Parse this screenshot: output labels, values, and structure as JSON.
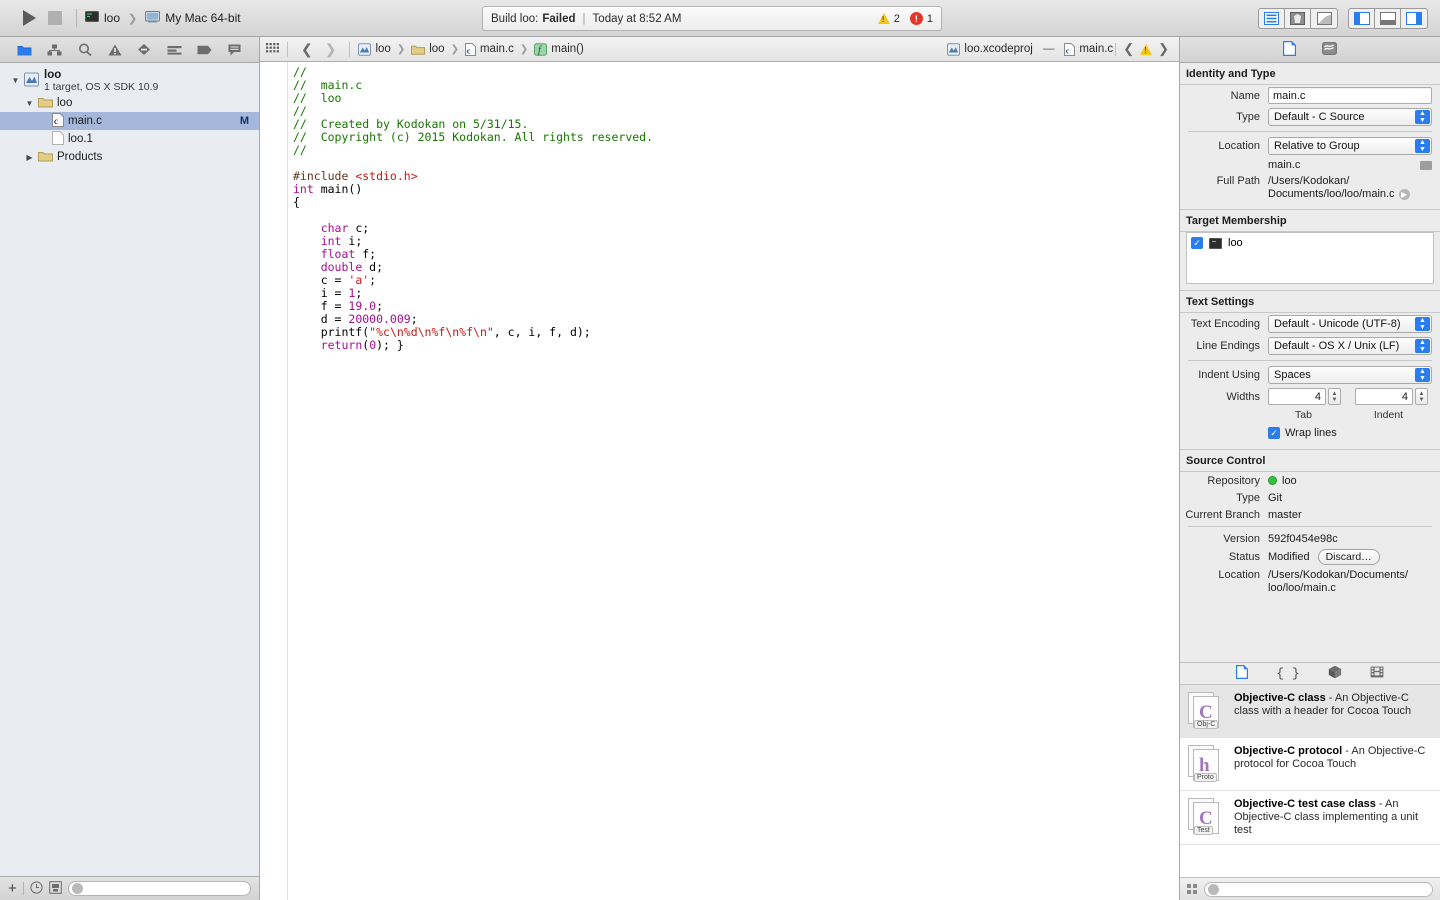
{
  "toolbar": {
    "run_label": "run-button",
    "stop_label": "stop-button",
    "scheme_name": "loo",
    "destination": "My Mac 64-bit",
    "status_prefix": "Build loo:",
    "status_result": "Failed",
    "status_divider": "|",
    "status_time": "Today at 8:52 AM",
    "warning_count": "2",
    "error_count": "1"
  },
  "navigator": {
    "tabs": [
      "project-navigator",
      "symbol-navigator",
      "find-navigator",
      "issue-navigator",
      "test-navigator",
      "debug-navigator",
      "breakpoint-navigator",
      "report-navigator"
    ],
    "tree": [
      {
        "label": "loo",
        "sublabel": "1 target, OS X SDK 10.9",
        "icon": "xcode-project-icon",
        "depth": 0,
        "expanded": true,
        "selected": false,
        "marker": ""
      },
      {
        "label": "loo",
        "sublabel": "",
        "icon": "folder-icon",
        "depth": 1,
        "expanded": true,
        "selected": false,
        "marker": ""
      },
      {
        "label": "main.c",
        "sublabel": "",
        "icon": "c-source-icon",
        "depth": 2,
        "expanded": null,
        "selected": true,
        "marker": "M"
      },
      {
        "label": "loo.1",
        "sublabel": "",
        "icon": "plain-file-icon",
        "depth": 2,
        "expanded": null,
        "selected": false,
        "marker": ""
      },
      {
        "label": "Products",
        "sublabel": "",
        "icon": "folder-icon",
        "depth": 1,
        "expanded": false,
        "selected": false,
        "marker": ""
      }
    ],
    "footer": {
      "add_label": "+",
      "filter_placeholder": ""
    }
  },
  "jumpbar": {
    "crumbs": [
      "loo",
      "loo",
      "main.c",
      "main()"
    ],
    "right_title_project": "loo.xcodeproj",
    "right_dash": "—",
    "right_title_file": "main.c"
  },
  "code": {
    "lines": [
      [
        {
          "t": "//",
          "c": "c-comment"
        }
      ],
      [
        {
          "t": "//  main.c",
          "c": "c-comment"
        }
      ],
      [
        {
          "t": "//  loo",
          "c": "c-comment"
        }
      ],
      [
        {
          "t": "//",
          "c": "c-comment"
        }
      ],
      [
        {
          "t": "//  Created by Kodokan on 5/31/15.",
          "c": "c-comment"
        }
      ],
      [
        {
          "t": "//  Copyright (c) 2015 Kodokan. All rights reserved.",
          "c": "c-comment"
        }
      ],
      [
        {
          "t": "//",
          "c": "c-comment"
        }
      ],
      [
        {
          "t": "",
          "c": ""
        }
      ],
      [
        {
          "t": "#include ",
          "c": "c-pre"
        },
        {
          "t": "<stdio.h>",
          "c": "c-hdr"
        }
      ],
      [
        {
          "t": "int",
          "c": "c-kw"
        },
        {
          "t": " main()",
          "c": "c-fn"
        }
      ],
      [
        {
          "t": "{",
          "c": "c-fn"
        }
      ],
      [
        {
          "t": "",
          "c": ""
        }
      ],
      [
        {
          "t": "    ",
          "c": ""
        },
        {
          "t": "char",
          "c": "c-kw"
        },
        {
          "t": " c;",
          "c": "c-fn"
        }
      ],
      [
        {
          "t": "    ",
          "c": ""
        },
        {
          "t": "int",
          "c": "c-kw"
        },
        {
          "t": " i;",
          "c": "c-fn"
        }
      ],
      [
        {
          "t": "    ",
          "c": ""
        },
        {
          "t": "float",
          "c": "c-kw"
        },
        {
          "t": " f;",
          "c": "c-fn"
        }
      ],
      [
        {
          "t": "    ",
          "c": ""
        },
        {
          "t": "double",
          "c": "c-kw"
        },
        {
          "t": " d;",
          "c": "c-fn"
        }
      ],
      [
        {
          "t": "    c = ",
          "c": "c-fn"
        },
        {
          "t": "'a'",
          "c": "c-str"
        },
        {
          "t": ";",
          "c": "c-fn"
        }
      ],
      [
        {
          "t": "    i = ",
          "c": "c-fn"
        },
        {
          "t": "1",
          "c": "c-esc"
        },
        {
          "t": ";",
          "c": "c-fn"
        }
      ],
      [
        {
          "t": "    f = ",
          "c": "c-fn"
        },
        {
          "t": "19.0",
          "c": "c-esc"
        },
        {
          "t": ";",
          "c": "c-fn"
        }
      ],
      [
        {
          "t": "    d = ",
          "c": "c-fn"
        },
        {
          "t": "20000.009",
          "c": "c-esc"
        },
        {
          "t": ";",
          "c": "c-fn"
        }
      ],
      [
        {
          "t": "    printf(",
          "c": "c-fn"
        },
        {
          "t": "\"%c\\n%d\\n%f\\n%f\\n\"",
          "c": "c-str"
        },
        {
          "t": ", c, i, f, d);",
          "c": "c-fn"
        }
      ],
      [
        {
          "t": "    ",
          "c": ""
        },
        {
          "t": "return",
          "c": "c-kw"
        },
        {
          "t": "(",
          "c": "c-fn"
        },
        {
          "t": "0",
          "c": "c-esc"
        },
        {
          "t": "); }",
          "c": "c-fn"
        }
      ]
    ]
  },
  "inspector": {
    "tabs": [
      "file-inspector",
      "quick-help-inspector"
    ],
    "identity": {
      "heading": "Identity and Type",
      "name_label": "Name",
      "name_value": "main.c",
      "type_label": "Type",
      "type_value": "Default - C Source",
      "location_label": "Location",
      "location_value": "Relative to Group",
      "location_file": "main.c",
      "fullpath_label": "Full Path",
      "fullpath_line1": "/Users/Kodokan/",
      "fullpath_line2": "Documents/loo/loo/main.c"
    },
    "target_membership": {
      "heading": "Target Membership",
      "items": [
        {
          "label": "loo",
          "checked": true
        }
      ]
    },
    "text_settings": {
      "heading": "Text Settings",
      "encoding_label": "Text Encoding",
      "encoding_value": "Default - Unicode (UTF-8)",
      "endings_label": "Line Endings",
      "endings_value": "Default - OS X / Unix (LF)",
      "indent_label": "Indent Using",
      "indent_value": "Spaces",
      "widths_label": "Widths",
      "tab_width": "4",
      "indent_width": "4",
      "tab_caption": "Tab",
      "indent_caption": "Indent",
      "wrap_label": "Wrap lines",
      "wrap_checked": true
    },
    "source_control": {
      "heading": "Source Control",
      "repository_label": "Repository",
      "repository_value": "loo",
      "type_label": "Type",
      "type_value": "Git",
      "branch_label": "Current Branch",
      "branch_value": "master",
      "version_label": "Version",
      "version_value": "592f0454e98c",
      "status_label": "Status",
      "status_value": "Modified",
      "discard_label": "Discard…",
      "location_label": "Location",
      "location_line1": "/Users/Kodokan/Documents/",
      "location_line2": "loo/loo/main.c"
    }
  },
  "library": {
    "tabs": [
      "file-template-library",
      "code-snippet-library",
      "object-library",
      "media-library"
    ],
    "items": [
      {
        "title": "Objective-C class",
        "desc": " - An Objective-C class with a header for Cocoa Touch",
        "glyph": "C",
        "tag": "Obj-C",
        "selected": true
      },
      {
        "title": "Objective-C protocol",
        "desc": " - An Objective-C protocol for Cocoa Touch",
        "glyph": "h",
        "tag": "Proto",
        "selected": false
      },
      {
        "title": "Objective-C test case class",
        "desc": " - An Objective-C class implementing a unit test",
        "glyph": "C",
        "tag": "Test",
        "selected": false
      }
    ],
    "footer": {
      "search_placeholder": ""
    }
  },
  "colors": {
    "selection_blue": "#a5b8dc",
    "accent_blue": "#2b7ced",
    "comment_green": "#177500",
    "keyword_magenta": "#aa0d91",
    "string_red": "#c41a16",
    "error_red": "#e0392c",
    "warning_yellow": "#f5c518",
    "repo_green": "#36c13c"
  }
}
